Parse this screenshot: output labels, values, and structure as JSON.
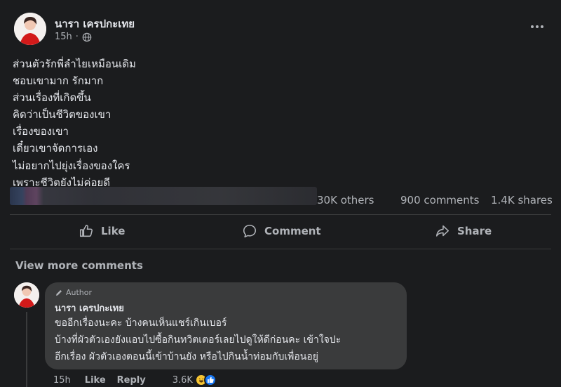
{
  "post": {
    "author": "นารา เครปกะเทย",
    "time": "15h",
    "lines": [
      "ส่วนตัวรักพี่ลำไยเหมือนเดิม",
      "ชอบเขามาก รักมาก",
      "ส่วนเรื่องที่เกิดขึ้น",
      "คิดว่าเป็นชีวิตของเขา",
      "เรื่องของเขา",
      "เดี๋ยวเขาจัดการเอง",
      "ไม่อยากไปยุ่งเรื่องของใคร",
      "เพราะชีวิตยังไม่ค่อยดี"
    ],
    "reactions_text": "30K others",
    "comments_text": "900 comments",
    "shares_text": "1.4K shares"
  },
  "actions": {
    "like": "Like",
    "comment": "Comment",
    "share": "Share"
  },
  "view_more_comments": "View more comments",
  "comment": {
    "badge": "Author",
    "author": "นารา เครปกะเทย",
    "lines": [
      "ขออีกเรื่องนะคะ บ้างคนเห็นแชร์เกินเบอร์",
      "บ้างที่ผัวตัวเองยังแอบไปซื้อกินทวิตเตอร์เลยไปดูให้ดีก่อนคะ เข้าใจปะ",
      "อีกเรื่อง ผัวตัวเองตอนนี้เข้าบ้านยัง หรือไปกินน้ำท่อมกับเพื่อนอยู่"
    ],
    "time": "15h",
    "like_label": "Like",
    "reply_label": "Reply",
    "reaction_count": "3.6K"
  },
  "colors": {
    "background": "#1b1c1e",
    "bubble": "#3a3b3c",
    "text": "#e4e6eb",
    "secondary_text": "#b0b3b8",
    "like_blue": "#1877f2",
    "haha_yellow": "#f7c532"
  },
  "icons": {
    "globe": "globe-icon",
    "more": "more-options-icon",
    "like": "thumbs-up-icon",
    "comment": "comment-bubble-icon",
    "share": "share-arrow-icon",
    "author_badge": "pencil-icon"
  }
}
